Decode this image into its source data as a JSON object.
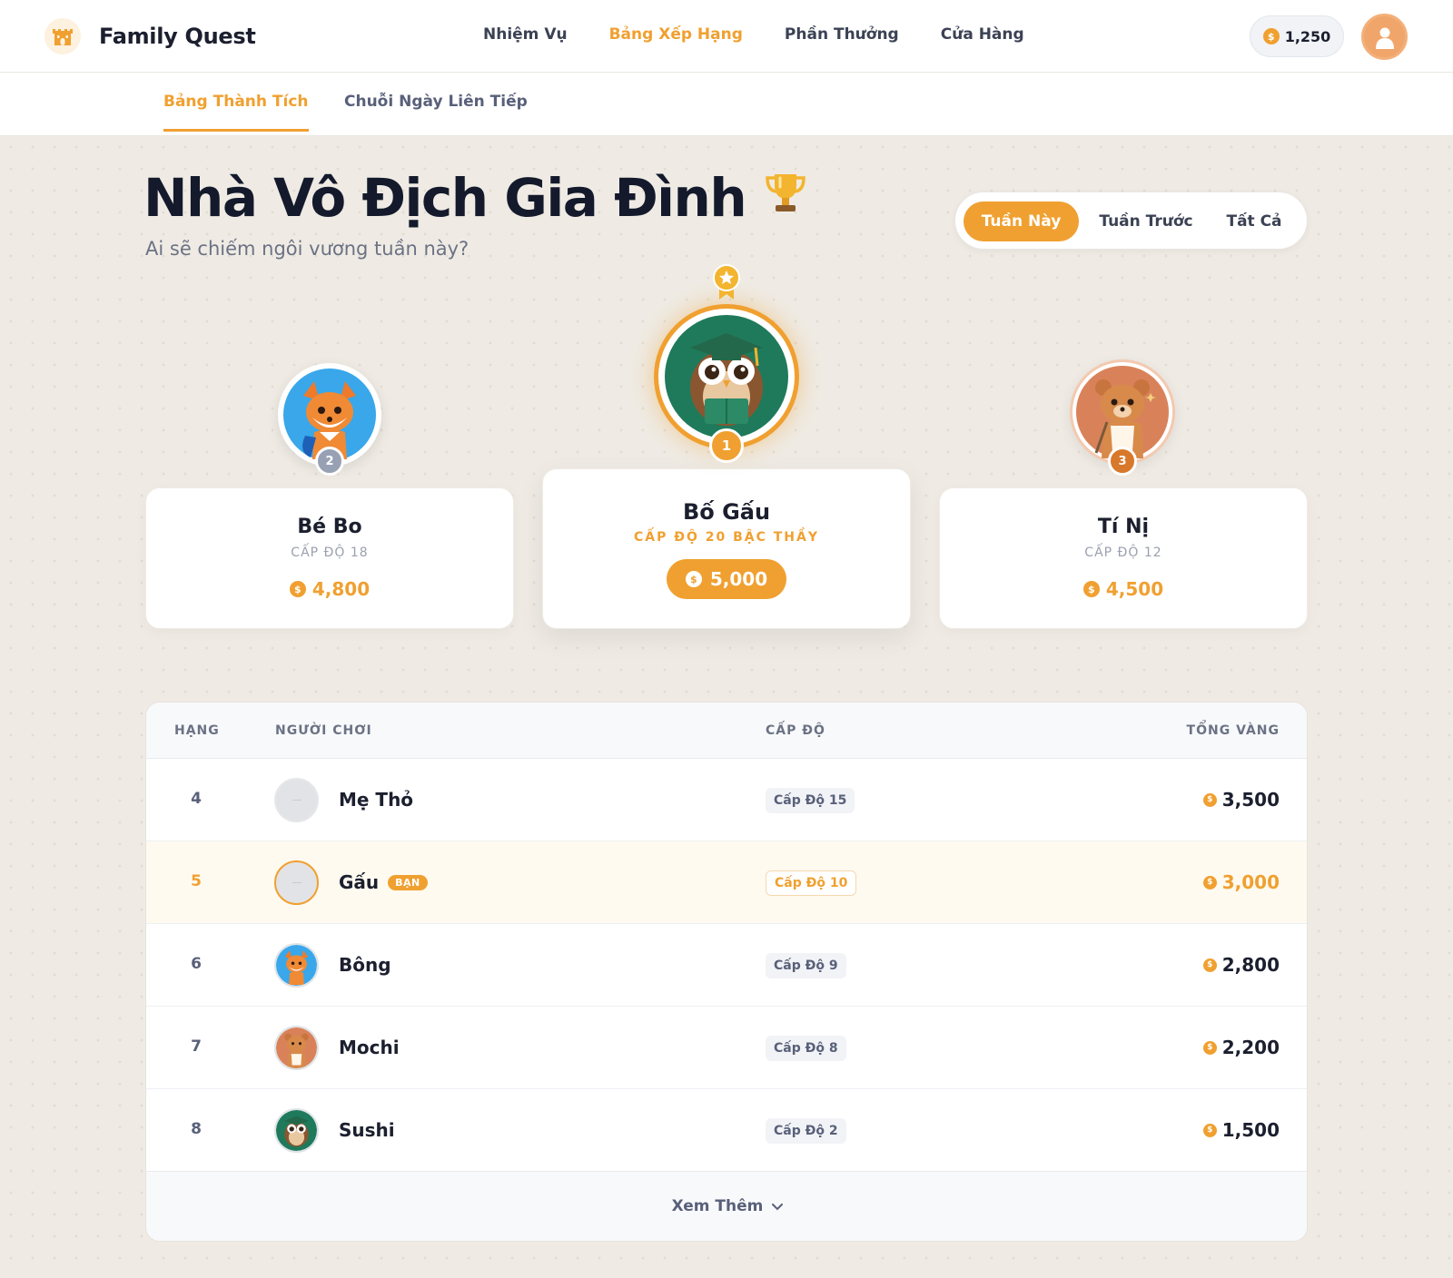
{
  "header": {
    "brand": "Family Quest",
    "nav": [
      "Nhiệm Vụ",
      "Bảng Xếp Hạng",
      "Phần Thưởng",
      "Cửa Hàng"
    ],
    "active_nav": "Bảng Xếp Hạng",
    "coins": "1,250"
  },
  "subtabs": {
    "achievements": "Bảng Thành Tích",
    "streak": "Chuỗi Ngày Liên Tiếp"
  },
  "hero": {
    "title": "Nhà Vô Địch Gia Đình",
    "subtitle": "Ai sẽ chiếm ngôi vương tuần này?",
    "ranges": [
      "Tuần Này",
      "Tuần Trước",
      "Tất Cả"
    ],
    "active_range": "Tuần Này"
  },
  "podium": {
    "first": {
      "rank": "1",
      "name": "Bố Gấu",
      "level": "CẤP ĐỘ 20 BẬC THẦY",
      "score": "5,000",
      "avatar": "owl-icon"
    },
    "second": {
      "rank": "2",
      "name": "Bé Bo",
      "level": "CẤP ĐỘ 18",
      "score": "4,800",
      "avatar": "fox-icon"
    },
    "third": {
      "rank": "3",
      "name": "Tí Nị",
      "level": "CẤP ĐỘ 12",
      "score": "4,500",
      "avatar": "bear-icon"
    }
  },
  "table": {
    "headers": {
      "rank": "HẠNG",
      "player": "NGƯỜI CHƠI",
      "level": "CẤP ĐỘ",
      "gold": "TỔNG VÀNG"
    },
    "you_badge": "BẠN",
    "rows": [
      {
        "rank": "4",
        "name": "Mẹ Thỏ",
        "level": "Cấp Độ 15",
        "gold": "3,500"
      },
      {
        "rank": "5",
        "name": "Gấu",
        "level": "Cấp Độ 10",
        "gold": "3,000"
      },
      {
        "rank": "6",
        "name": "Bông",
        "level": "Cấp Độ 9",
        "gold": "2,800"
      },
      {
        "rank": "7",
        "name": "Mochi",
        "level": "Cấp Độ 8",
        "gold": "2,200"
      },
      {
        "rank": "8",
        "name": "Sushi",
        "level": "Cấp Độ 2",
        "gold": "1,500"
      }
    ],
    "more": "Xem Thêm"
  },
  "colors": {
    "accent": "#f0a030",
    "text": "#1b1f2e",
    "muted": "#6b7284"
  }
}
